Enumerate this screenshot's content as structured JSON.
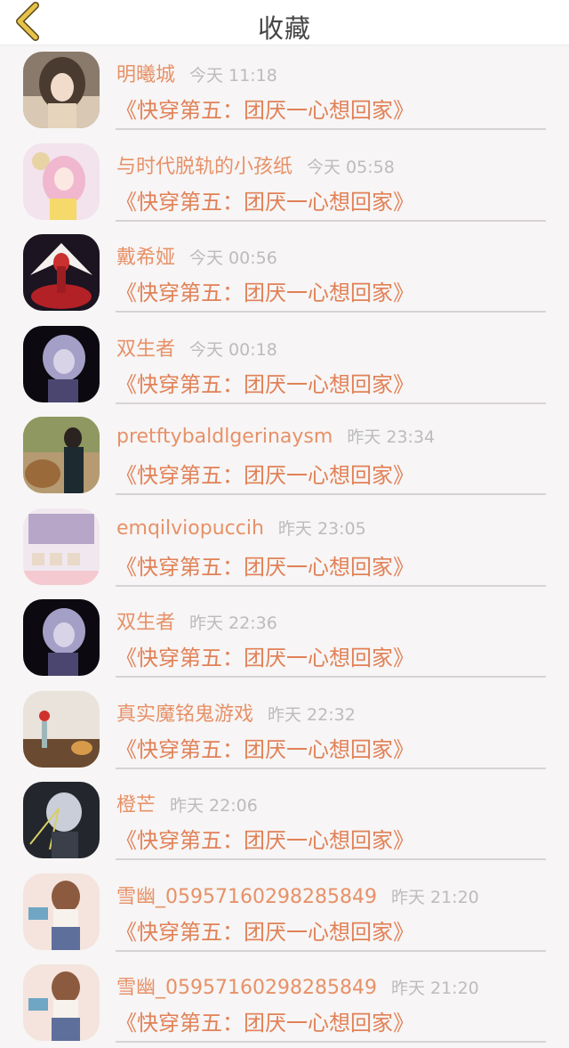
{
  "header": {
    "title": "收藏",
    "back_icon": "chevron-left-icon",
    "back_icon_color": "#e6c349"
  },
  "colors": {
    "name": "#e79168",
    "time": "#bcbcbc",
    "book": "#e18157",
    "divider": "#d8d3d3",
    "background": "#f7f5f5"
  },
  "items": [
    {
      "name": "明曦城",
      "time": "今天 11:18",
      "book": "《快穿第五：团厌一心想回家》"
    },
    {
      "name": "与时代脱轨的小孩纸",
      "time": "今天 05:58",
      "book": "《快穿第五：团厌一心想回家》"
    },
    {
      "name": "戴希娅",
      "time": "今天 00:56",
      "book": "《快穿第五：团厌一心想回家》"
    },
    {
      "name": "双生者",
      "time": "今天 00:18",
      "book": "《快穿第五：团厌一心想回家》"
    },
    {
      "name": "pretftybaldlgerinaysm",
      "time": "昨天 23:34",
      "book": "《快穿第五：团厌一心想回家》"
    },
    {
      "name": "emqilviopuccih",
      "time": "昨天 23:05",
      "book": "《快穿第五：团厌一心想回家》"
    },
    {
      "name": "双生者",
      "time": "昨天 22:36",
      "book": "《快穿第五：团厌一心想回家》"
    },
    {
      "name": "真实魔铭鬼游戏",
      "time": "昨天 22:32",
      "book": "《快穿第五：团厌一心想回家》"
    },
    {
      "name": "橙芒",
      "time": "昨天 22:06",
      "book": "《快穿第五：团厌一心想回家》"
    },
    {
      "name": "雪幽_05957160298285849",
      "time": "昨天 21:20",
      "book": "《快穿第五：团厌一心想回家》"
    },
    {
      "name": "雪幽_05957160298285849",
      "time": "昨天 21:20",
      "book": "《快穿第五：团厌一心想回家》"
    }
  ]
}
